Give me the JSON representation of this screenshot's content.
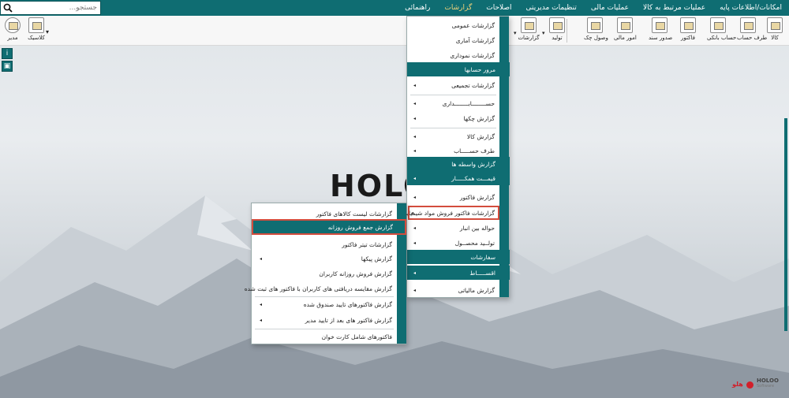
{
  "menubar": {
    "items": [
      "امکانات/اطلاعات پایه",
      "عملیات مرتبط به کالا",
      "عملیات مالی",
      "تنظیمات مدیریتی",
      "اصلاحات",
      "گزارشات",
      "راهنمائی"
    ],
    "active_index": 5
  },
  "search": {
    "placeholder": "جستجو..."
  },
  "toolbar": {
    "kala": "کالا",
    "taraf_hesab": "طرف حساب",
    "hesab_banki": "حساب بانکی",
    "factor": "فاکتور",
    "sodoor_sanad": "صدور سند",
    "omoor_mali": "امور مالی",
    "vosool_chek": "وصول چک",
    "tolid": "تولید",
    "gozareshat": "گزارشات",
    "modir": "مدیر",
    "classic": "کلاسیک"
  },
  "logo_text": "HOLO",
  "brand": {
    "name": "HOLOO",
    "sub": "Software",
    "fa": "هلو"
  },
  "reports_menu": [
    "گزارشات عمومی",
    "گزارشات آماری",
    "گزارشات نموداری",
    "مرور حسابها",
    "گزارشات تجمیعی",
    "حســــــــابــــــــداری",
    "گزارش چکها",
    "گزارش کالا",
    "طرف حســـــاب",
    "گزارش واسطه ها",
    "قیمـــت همکـــــار",
    "گزارش فاکتور",
    "گزارشات فاکتور فروش مواد شیمیایی",
    "حواله بین انبار",
    "تولــید محصــول",
    "سفارشات",
    "اقســـــاط",
    "گزارش مالیاتی"
  ],
  "submenu": [
    "گزارشات لیست کالاهای فاکتور",
    "گزارش جمع فروش روزانه",
    "گزارشات تیتر فاکتور",
    "گزارش پیکها",
    "گزارش فروش روزانه کاربران",
    "گزارش مقایسه دریافتی های  کاربران با فاکتور های ثبت شده",
    "گزارش فاکتورهای تایید صندوق شده",
    "گزارش فاکتور های بعد از تایید مدیر",
    "فاکتورهای شامل کارت خوان"
  ]
}
